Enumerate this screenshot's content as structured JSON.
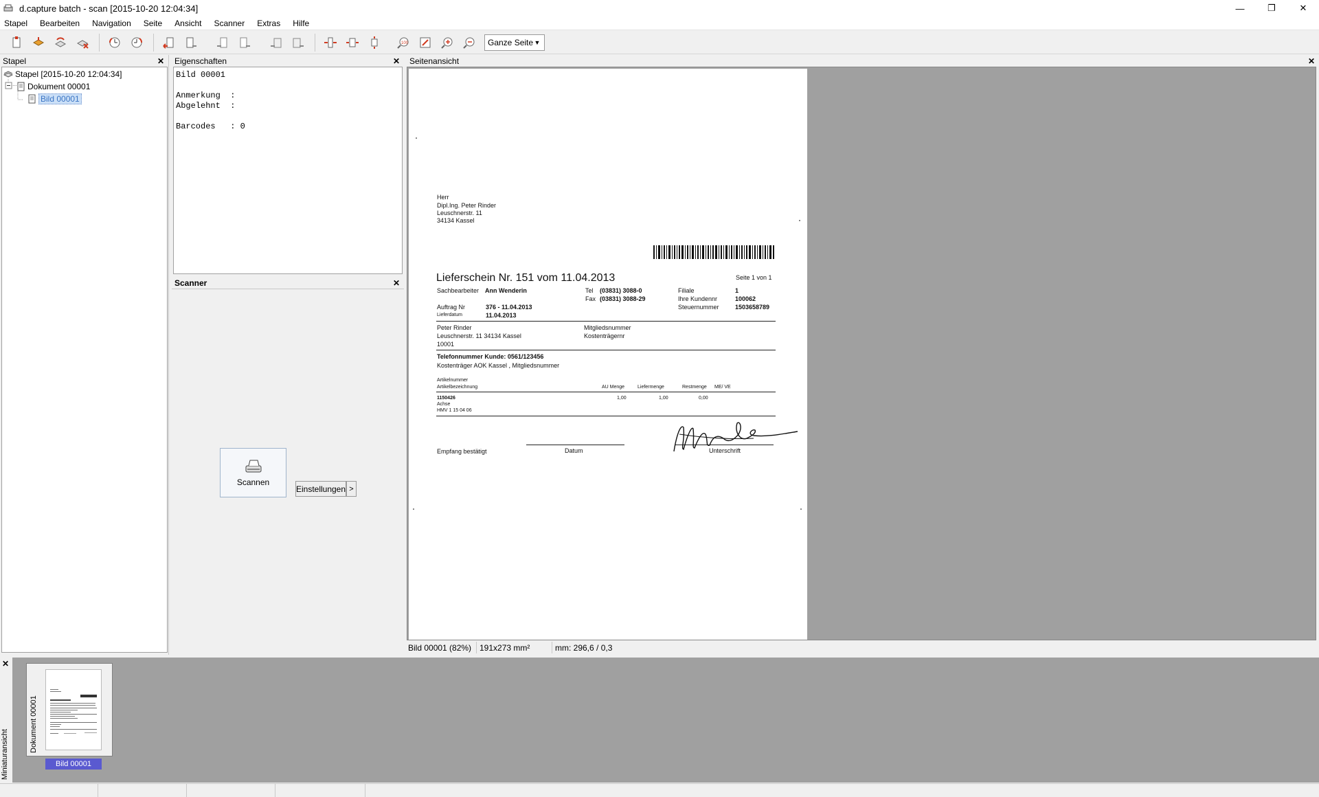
{
  "window": {
    "title": "d.capture batch - scan [2015-10-20 12:04:34]",
    "minimize_icon": "minimize-icon",
    "restore_icon": "restore-icon",
    "close_icon": "close-icon"
  },
  "menu": {
    "items": [
      "Stapel",
      "Bearbeiten",
      "Navigation",
      "Seite",
      "Ansicht",
      "Scanner",
      "Extras",
      "Hilfe"
    ]
  },
  "toolbar": {
    "zoom_value": "Ganze Seite"
  },
  "stapel_panel": {
    "title": "Stapel",
    "tree": {
      "root": "Stapel [2015-10-20 12:04:34]",
      "document": "Dokument 00001",
      "image": "Bild 00001"
    }
  },
  "properties_panel": {
    "title": "Eigenschaften",
    "lines": [
      "Bild 00001",
      "",
      "Anmerkung  :",
      "Abgelehnt  :",
      "",
      "Barcodes   : 0"
    ]
  },
  "scanner_panel": {
    "title": "Scanner",
    "scan_label": "Scannen",
    "settings_label": "Einstellungen",
    "settings_arrow": ">"
  },
  "page_view": {
    "title": "Seitenansicht",
    "status": {
      "image_zoom": "Bild 00001 (82%)",
      "size": "191x273 mm²",
      "position": "mm: 296,6 / 0,3"
    }
  },
  "document": {
    "address": [
      "Herr",
      "Dipl.Ing. Peter Rinder",
      "Leuschnerstr. 11",
      "34134 Kassel"
    ],
    "title": "Lieferschein Nr. 151 vom 11.04.2013",
    "page_info": "Seite 1 von 1",
    "sachbearbeiter_label": "Sachbearbeiter",
    "sachbearbeiter_value": "Ann Wenderin",
    "tel_label": "Tel",
    "tel_value": "(03831) 3088-0",
    "fax_label": "Fax",
    "fax_value": "(03831) 3088-29",
    "filiale_label": "Filiale",
    "filiale_value": "1",
    "kundennr_label": "Ihre Kundennr",
    "kundennr_value": "100062",
    "steuer_label": "Steuernummer",
    "steuer_value": "1503658789",
    "auftrag_label": "Auftrag Nr",
    "auftrag_value": "376 - 11.04.2013",
    "lieferdatum_label": "Lieferdatum",
    "lieferdatum_value": "11.04.2013",
    "patient_lines": [
      "Peter Rinder",
      "Leuschnerstr. 11 34134 Kassel",
      "10001"
    ],
    "mitglied_label": "Mitgliedsnummer",
    "kostentraegernr_label": "Kostenträgernr",
    "phone_line": "Telefonnummer Kunde: 0561/123456",
    "kostentraeger_line": "Kostenträger  AOK Kassel , Mitgliedsnummer",
    "table_headers": {
      "artikelnummer": "Artikelnummer",
      "artikelbezeichnung": "Artikelbezeichnung",
      "au_menge": "AU Menge",
      "liefermenge": "Liefermenge",
      "restmenge": "Restmenge",
      "me_ve": "ME/ VE"
    },
    "row": {
      "nummer": "1150426",
      "bezeichnung": "Achse",
      "hmv": "HMV 1 15 04 06",
      "au_menge": "1,00",
      "liefermenge": "1,00",
      "restmenge": "0,00"
    },
    "empfang_label": "Empfang bestätigt",
    "datum_label": "Datum",
    "unterschrift_label": "Unterschrift"
  },
  "thumbnails": {
    "sidebar_label": "Miniaturansicht",
    "doc_label": "Dokument 00001",
    "caption": "Bild 00001"
  },
  "colors": {
    "selection": "#5a5ad0",
    "workspace": "#a0a0a0",
    "toolbar_red": "#d03a20",
    "toolbar_orange": "#e8a030"
  }
}
